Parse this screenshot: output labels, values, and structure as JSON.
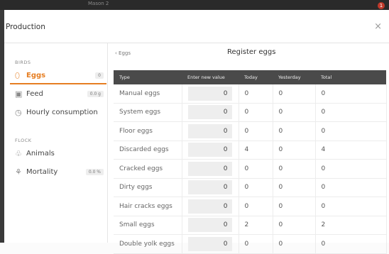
{
  "topbar": {
    "title": "Mason 2",
    "notification_count": "1"
  },
  "modal": {
    "title": "Production",
    "close_icon": "×"
  },
  "sidebar": {
    "birds_label": "BIRDS",
    "flock_label": "FLOCK",
    "birds_items": [
      {
        "icon": "egg-icon",
        "label": "Eggs",
        "badge": "0"
      },
      {
        "icon": "feed-icon",
        "label": "Feed",
        "badge": "0.0 g"
      },
      {
        "icon": "clock-icon",
        "label": "Hourly consumption",
        "badge": ""
      }
    ],
    "flock_items": [
      {
        "icon": "bird-icon",
        "label": "Animals",
        "badge": ""
      },
      {
        "icon": "mortality-icon",
        "label": "Mortality",
        "badge": "0.0 %"
      }
    ]
  },
  "main": {
    "back_label": "Eggs",
    "title": "Register eggs",
    "columns": [
      "Type",
      "Enter new value",
      "Today",
      "Yesterday",
      "Total"
    ],
    "rows": [
      {
        "type": "Manual eggs",
        "value": "0",
        "today": "0",
        "yesterday": "0",
        "total": "0"
      },
      {
        "type": "System eggs",
        "value": "0",
        "today": "0",
        "yesterday": "0",
        "total": "0"
      },
      {
        "type": "Floor eggs",
        "value": "0",
        "today": "0",
        "yesterday": "0",
        "total": "0"
      },
      {
        "type": "Discarded eggs",
        "value": "0",
        "today": "4",
        "yesterday": "0",
        "total": "4"
      },
      {
        "type": "Cracked eggs",
        "value": "0",
        "today": "0",
        "yesterday": "0",
        "total": "0"
      },
      {
        "type": "Dirty eggs",
        "value": "0",
        "today": "0",
        "yesterday": "0",
        "total": "0"
      },
      {
        "type": "Hair cracks eggs",
        "value": "0",
        "today": "0",
        "yesterday": "0",
        "total": "0"
      },
      {
        "type": "Small eggs",
        "value": "0",
        "today": "2",
        "yesterday": "0",
        "total": "2"
      },
      {
        "type": "Double yolk eggs",
        "value": "0",
        "today": "0",
        "yesterday": "0",
        "total": "0"
      }
    ]
  },
  "colors": {
    "accent": "#e67e22",
    "header_bg": "#4a4a4a",
    "input_bg": "#eeeeee"
  }
}
